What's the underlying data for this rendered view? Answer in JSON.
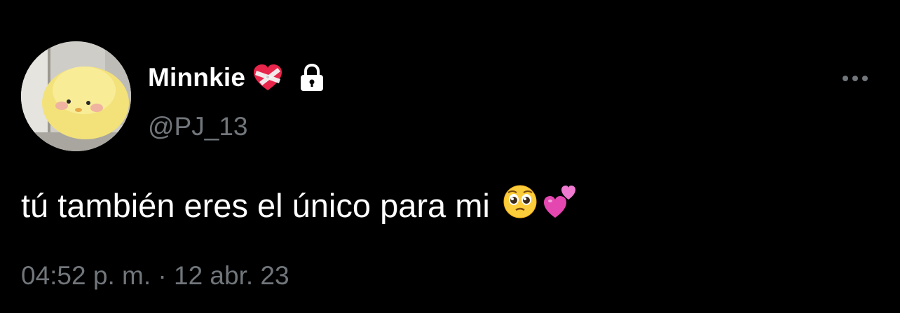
{
  "tweet": {
    "author": {
      "display_name": "Minnkie",
      "name_emoji": "mending-heart-emoji",
      "protected_icon": "lock-icon",
      "handle": "@PJ_13"
    },
    "more_icon": "more-horizontal-icon",
    "text": "tú también eres el único para mi",
    "text_emojis": [
      "pleading-face-emoji",
      "two-hearts-emoji"
    ],
    "timestamp": "04:52 p. m. · 12 abr. 23"
  },
  "colors": {
    "background": "#000000",
    "primary_text": "#ffffff",
    "secondary_text": "#71767b"
  }
}
